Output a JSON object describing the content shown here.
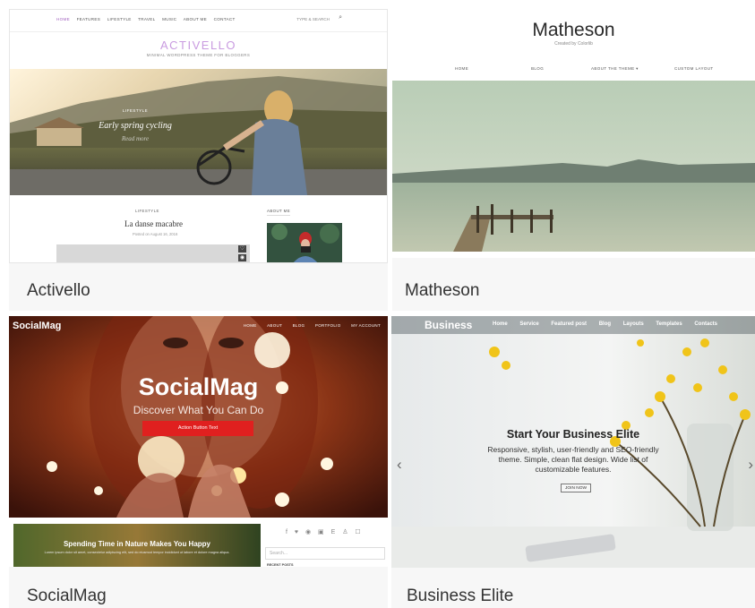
{
  "themes": [
    {
      "caption": "Activello",
      "preview": {
        "nav": [
          "HOME",
          "FEATURES",
          "LIFESTYLE",
          "TRAVEL",
          "MUSIC",
          "ABOUT ME",
          "CONTACT"
        ],
        "search_placeholder": "TYPE & SEARCH",
        "logo": "ACTIVELLO",
        "tagline": "MINIMAL WORDPRESS THEME FOR BLOGGERS",
        "hero_category": "LIFESTYLE",
        "hero_title": "Early spring cycling",
        "hero_more": "Read more",
        "post_category": "LIFESTYLE",
        "post_title": "La danse macabre",
        "post_date": "Posted on August 16, 2016",
        "sidebar_heading": "ABOUT ME"
      }
    },
    {
      "caption": "Matheson",
      "preview": {
        "logo": "Matheson",
        "tagline": "Created by Colorlib",
        "nav": [
          "HOME",
          "BLOG",
          "ABOUT THE THEME ▾",
          "CUSTOM LAYOUT"
        ]
      }
    },
    {
      "caption": "SocialMag",
      "preview": {
        "logo": "SocialMag",
        "nav": [
          "HOME",
          "ABOUT",
          "BLOG",
          "PORTFOLIO",
          "MY ACCOUNT"
        ],
        "title": "SocialMag",
        "subtitle": "Discover What You Can Do",
        "button": "Action Button Text",
        "post_title": "Spending Time in Nature Makes You Happy",
        "post_snippet": "Lorem ipsum dolor sit amet, consectetur adipiscing elit, sed do eiusmod tempor incididunt ut labore et dolore magna aliqua.",
        "social_icons": "f ♥ ◉ ▣ E ♙ ☐",
        "search_placeholder": "Search...",
        "recent_label": "RECENT POSTS"
      }
    },
    {
      "caption": "Business Elite",
      "preview": {
        "logo": "Business",
        "nav": [
          "Home",
          "Service",
          "Featured post",
          "Blog",
          "Layouts",
          "Templates",
          "Contacts"
        ],
        "title": "Start Your Business Elite",
        "description": "Responsive, stylish, user-friendly and SEO-friendly theme. Simple, clean flat design. Wide list of customizable features.",
        "button": "JOIN NOW",
        "prev_arrow": "‹",
        "next_arrow": "›"
      }
    }
  ],
  "colors": {
    "caption_bg": "#f7f7f7",
    "activello_accent": "#a161bf",
    "socialmag_button": "#e0201f"
  }
}
